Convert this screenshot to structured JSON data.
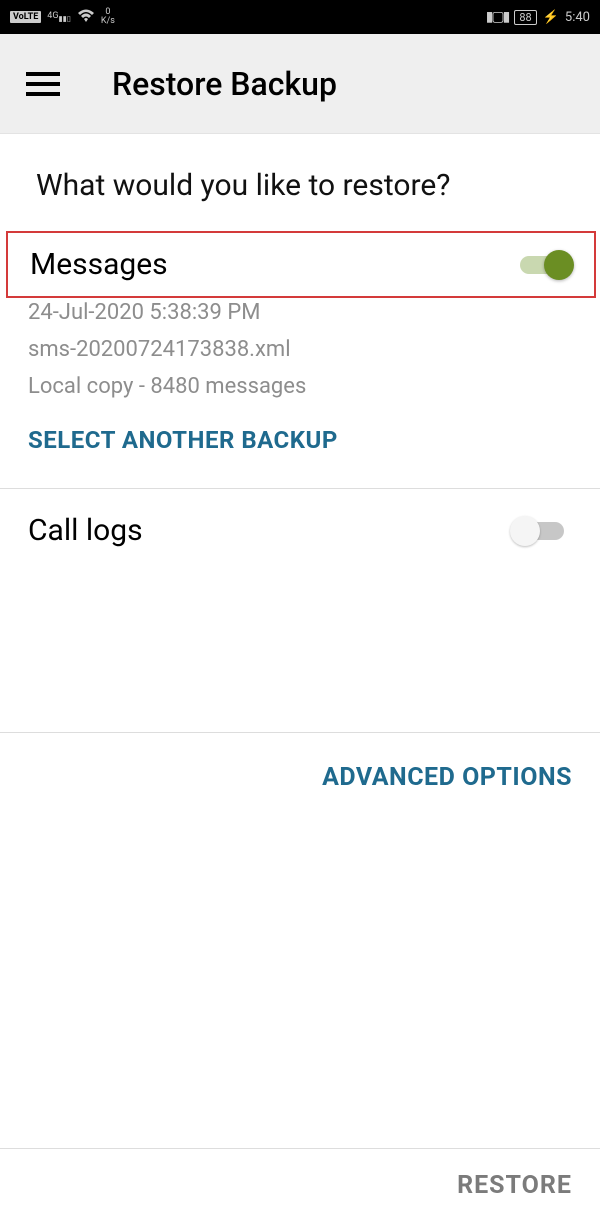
{
  "status": {
    "volte": "VoLTE",
    "net": "4G",
    "speed_num": "0",
    "speed_unit": "K/s",
    "battery": "88",
    "time": "5:40"
  },
  "header": {
    "title": "Restore Backup"
  },
  "question": "What would you like to restore?",
  "messages": {
    "title": "Messages",
    "enabled": true,
    "meta1": "24-Jul-2020 5:38:39 PM",
    "meta2": "sms-20200724173838.xml",
    "meta3": "Local copy - 8480 messages",
    "select_another": "SELECT ANOTHER BACKUP"
  },
  "calllogs": {
    "title": "Call logs",
    "enabled": false
  },
  "advanced": "ADVANCED OPTIONS",
  "restore": "RESTORE"
}
